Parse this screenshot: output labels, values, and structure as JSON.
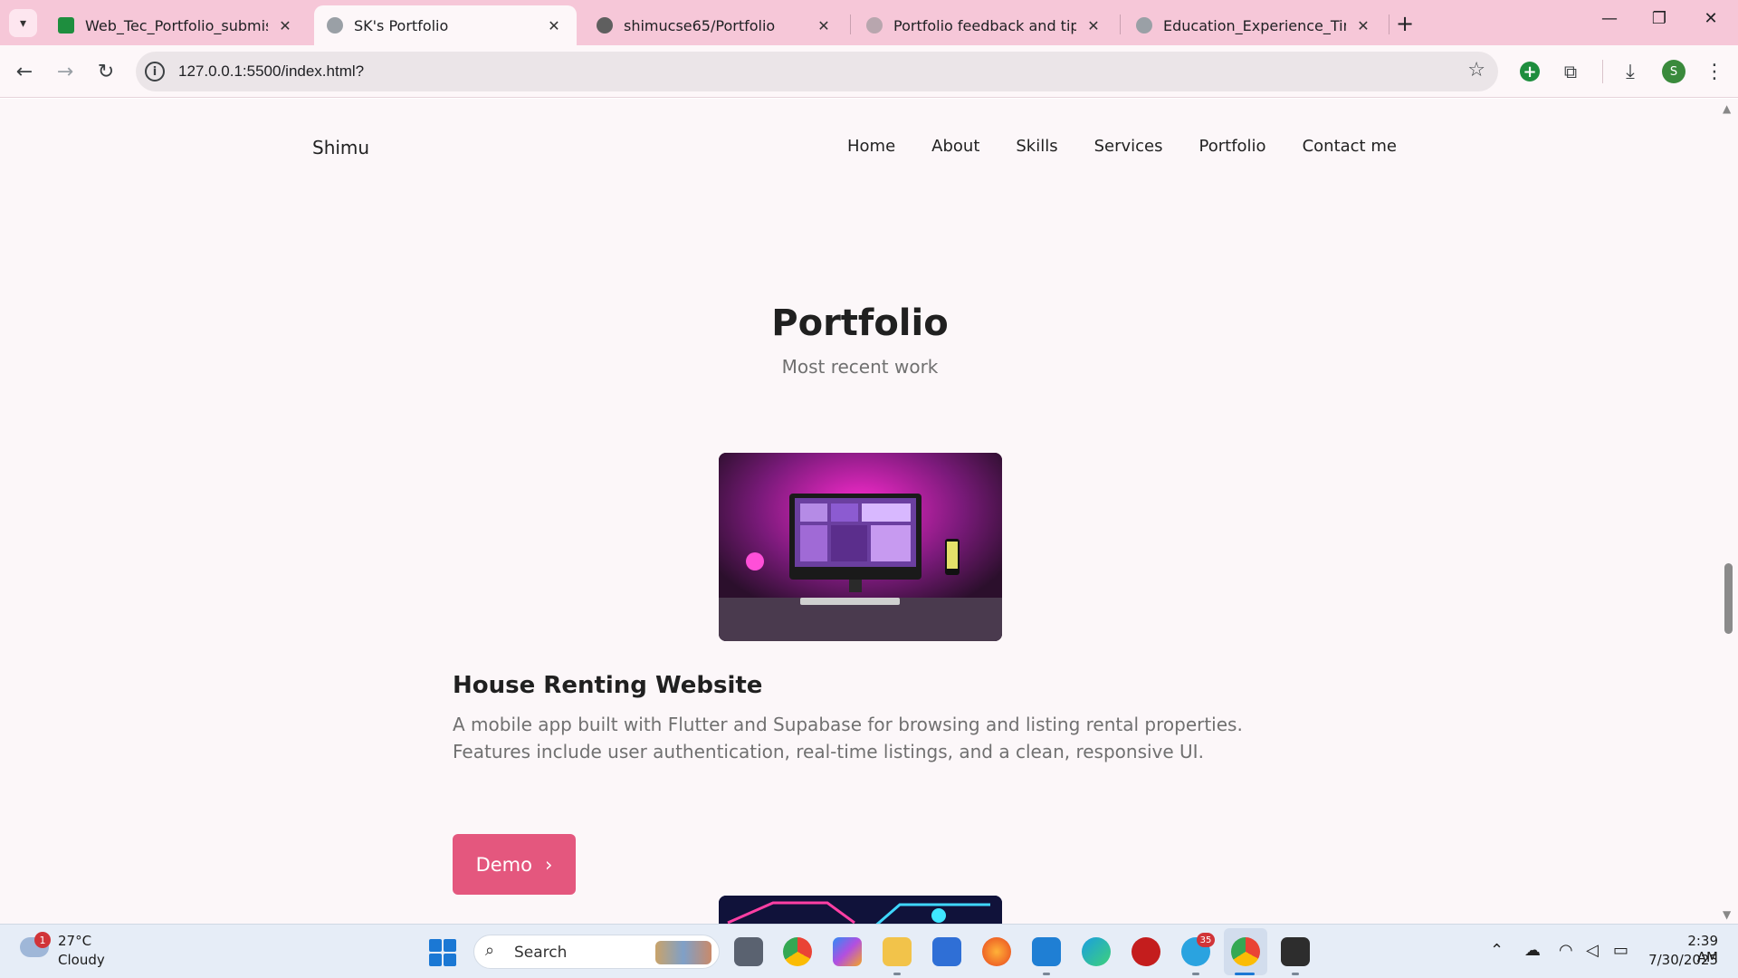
{
  "browser": {
    "tabs": [
      {
        "label": "Web_Tec_Portfolio_submission",
        "favicon": "sheets-icon",
        "color": "#1e8e3e"
      },
      {
        "label": "SK's Portfolio",
        "favicon": "globe-icon",
        "color": "#8a8a8a",
        "active": true
      },
      {
        "label": "shimucse65/Portfolio",
        "favicon": "github-icon",
        "color": "#6a6a6a"
      },
      {
        "label": "Portfolio feedback and tips",
        "favicon": "chatgpt-icon",
        "color": "#9a9a9a"
      },
      {
        "label": "Education_Experience_Timeline",
        "favicon": "globe-icon",
        "color": "#8a8a8a"
      }
    ],
    "url": "127.0.0.1:5500/index.html?",
    "profile_initial": "S"
  },
  "site": {
    "logo": "Shimu",
    "nav": [
      "Home",
      "About",
      "Skills",
      "Services",
      "Portfolio",
      "Contact me"
    ],
    "section_title": "Portfolio",
    "section_subtitle": "Most recent work",
    "project": {
      "title": "House Renting Website",
      "description": "A mobile app built with Flutter and Supabase for browsing and listing rental properties. Features include user authentication, real-time listings, and a clean, responsive UI.",
      "button_label": "Demo",
      "button_icon": "chevron-right-icon",
      "accent": "#e4577e"
    }
  },
  "taskbar": {
    "weather_temp": "27°C",
    "weather_desc": "Cloudy",
    "weather_badge": "1",
    "search_label": "Search",
    "telegram_badge": "35",
    "time": "2:39 AM",
    "date": "7/30/2025"
  }
}
